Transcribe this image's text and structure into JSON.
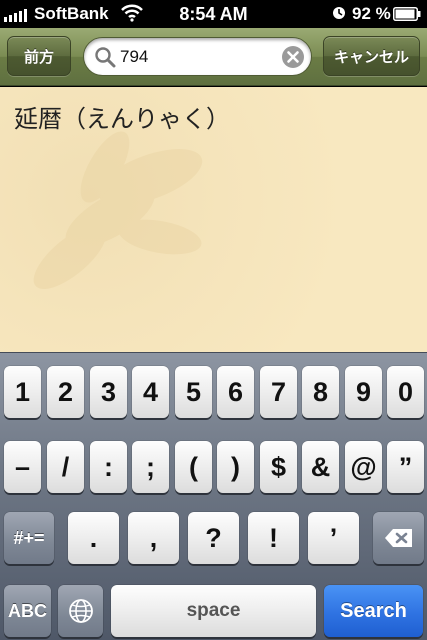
{
  "status_bar": {
    "carrier": "SoftBank",
    "time": "8:54 AM",
    "battery": "92 %"
  },
  "nav": {
    "back_label": "前方",
    "search_value": "794",
    "cancel_label": "キャンセル"
  },
  "content": {
    "entry": "延暦（えんりゃく）"
  },
  "keyboard": {
    "row1": [
      "1",
      "2",
      "3",
      "4",
      "5",
      "6",
      "7",
      "8",
      "9",
      "0"
    ],
    "row2": [
      "–",
      "/",
      ":",
      ";",
      "(",
      ")",
      "$",
      "&",
      "@",
      "”"
    ],
    "shift_label": "#+=",
    "row3": [
      ".",
      ",",
      "?",
      "!",
      "’"
    ],
    "abc_label": "ABC",
    "space_label": "space",
    "search_label": "Search"
  },
  "colors": {
    "nav_bar": "#7b8c53",
    "content_bg": "#f8e8c0",
    "search_key": "#2f73e2"
  }
}
